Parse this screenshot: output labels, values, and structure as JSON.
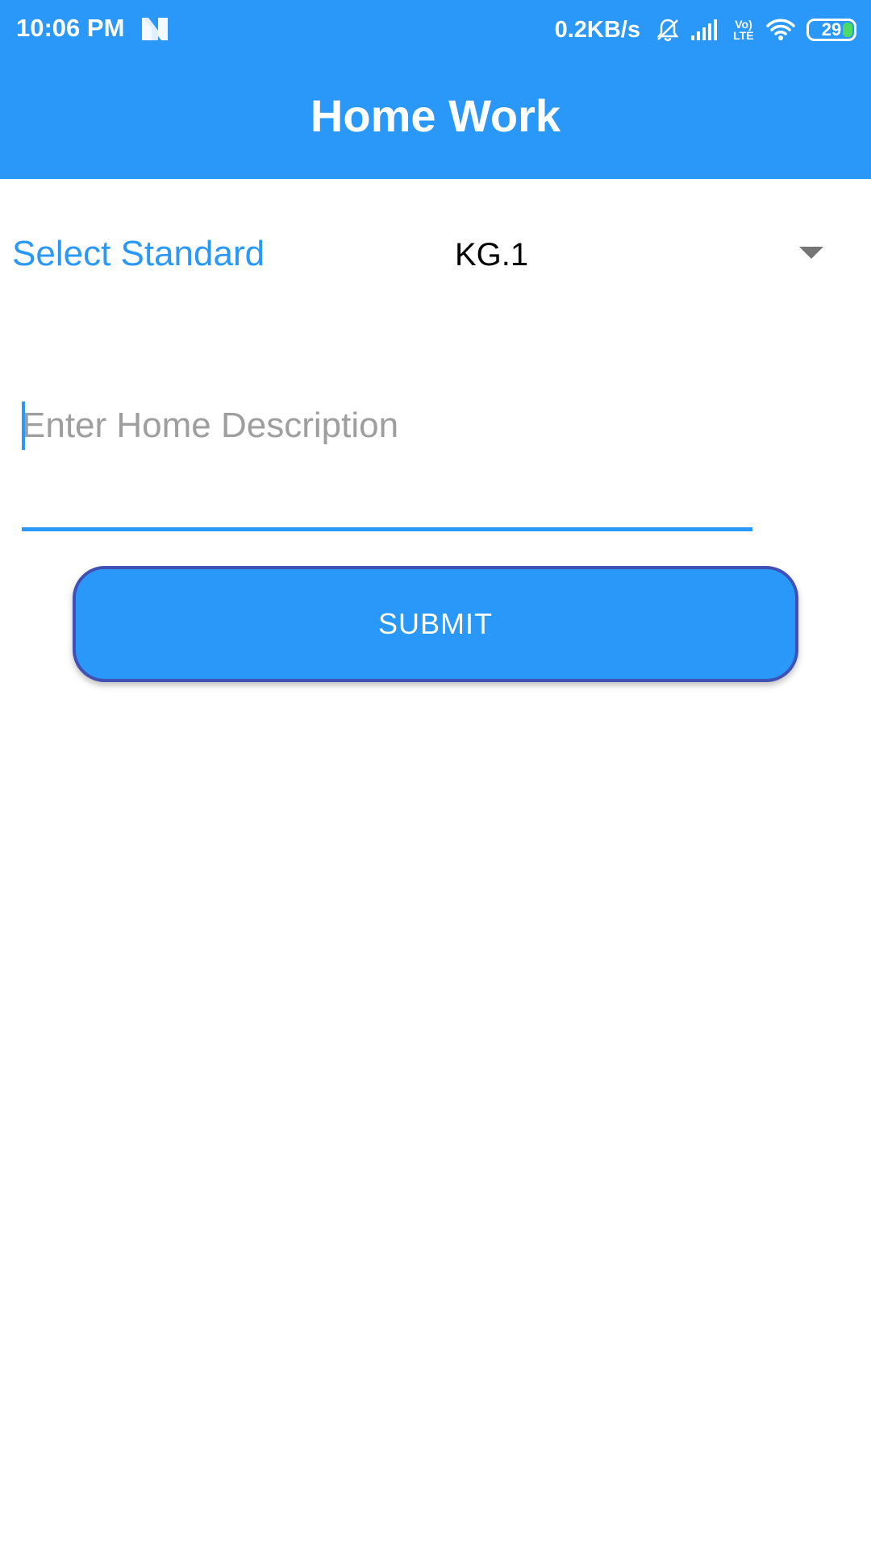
{
  "status_bar": {
    "time": "10:06 PM",
    "notification_icon": "n-notification-icon",
    "network_speed": "0.2KB/s",
    "mute_icon": "bell-off-icon",
    "signal_icon": "signal-bars-icon",
    "volte_label_top": "Vo)",
    "volte_label_bottom": "LTE",
    "wifi_icon": "wifi-icon",
    "battery_level": "29",
    "battery_fill_color": "#4cd964"
  },
  "app_bar": {
    "title": "Home Work",
    "background_color": "#2a98f8"
  },
  "form": {
    "standard_label": "Select Standard",
    "standard_value": "KG.1",
    "standard_dropdown_icon": "dropdown-arrow-icon",
    "description_placeholder": "Enter Home Description",
    "description_value": "",
    "submit_label": "SUBMIT"
  },
  "colors": {
    "accent": "#2a98f8",
    "button_border": "#3f51b5",
    "placeholder": "#9e9e9e"
  }
}
